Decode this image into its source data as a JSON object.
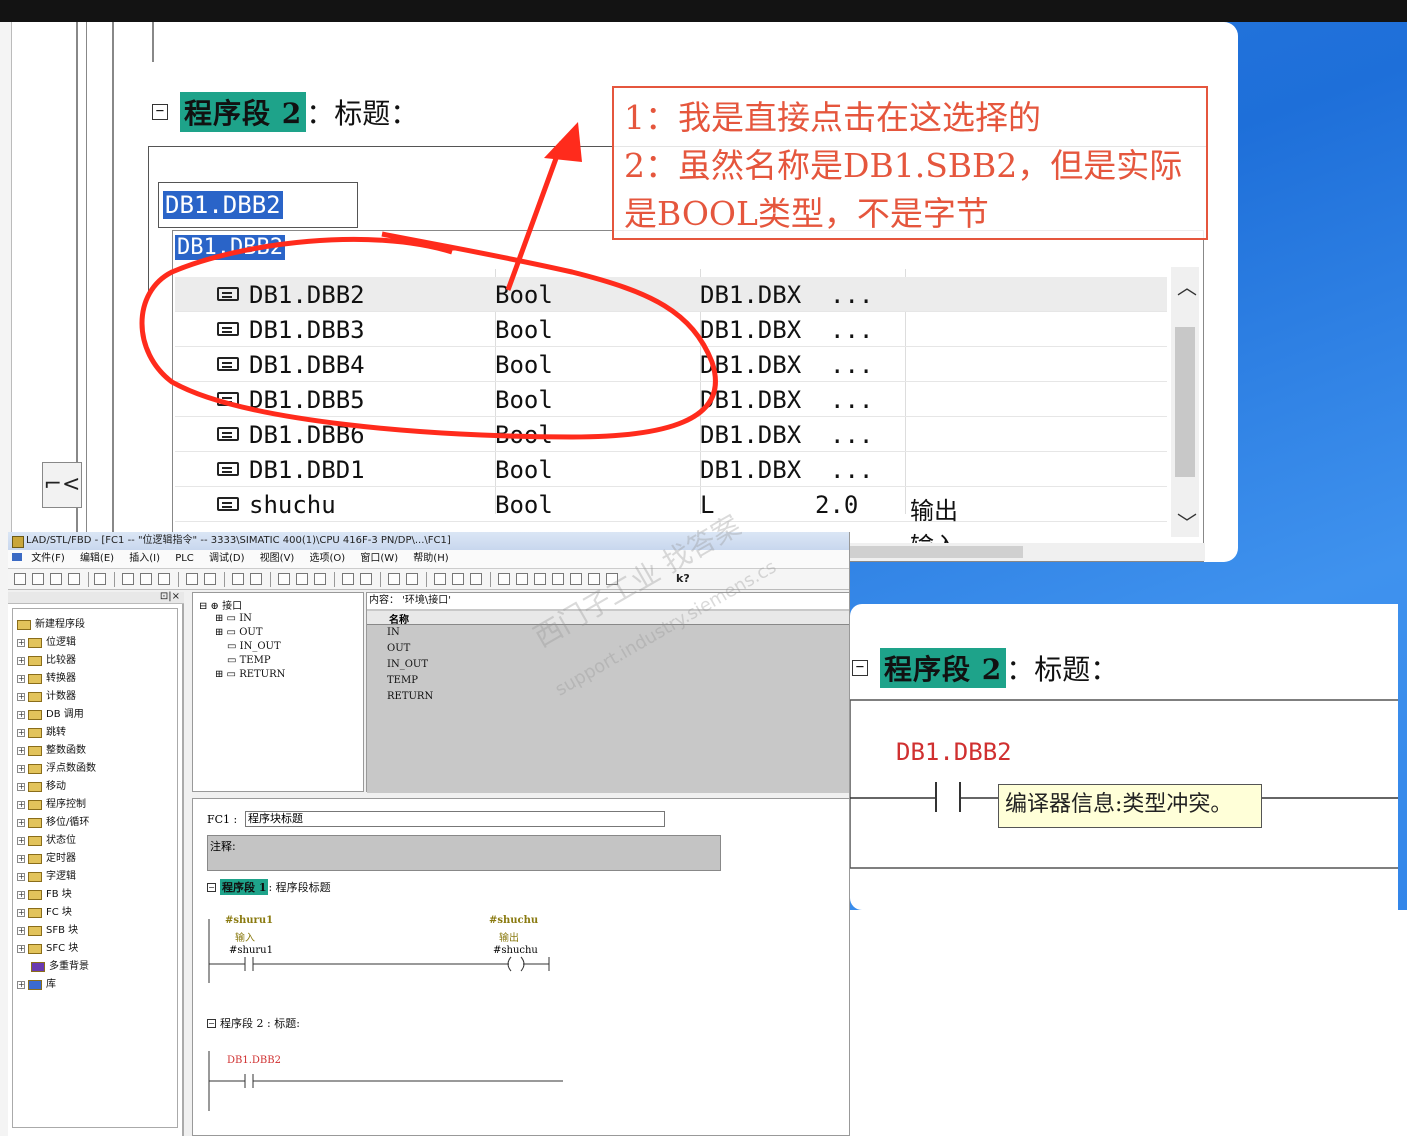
{
  "note": {
    "line1": "1：我是直接点击在这选择的",
    "line2": "2：虽然名称是DB1.SBB2，但是实际",
    "line3": "是BOOL类型，不是字节"
  },
  "zoom_top": {
    "network_prefix": "程序段 2",
    "network_suffix": "：标题：",
    "input_value": "DB1.DBB2",
    "dropdown_header": "DB1.DBB2",
    "rows": [
      {
        "name": "DB1.DBB2",
        "type": "Bool",
        "addr": "DB1.DBX",
        "extra": "...",
        "comment": ""
      },
      {
        "name": "DB1.DBB3",
        "type": "Bool",
        "addr": "DB1.DBX",
        "extra": "...",
        "comment": ""
      },
      {
        "name": "DB1.DBB4",
        "type": "Bool",
        "addr": "DB1.DBX",
        "extra": "...",
        "comment": ""
      },
      {
        "name": "DB1.DBB5",
        "type": "Bool",
        "addr": "DB1.DBX",
        "extra": "...",
        "comment": ""
      },
      {
        "name": "DB1.DBB6",
        "type": "Bool",
        "addr": "DB1.DBX",
        "extra": "...",
        "comment": ""
      },
      {
        "name": "DB1.DBD1",
        "type": "Bool",
        "addr": "DB1.DBX",
        "extra": "...",
        "comment": ""
      },
      {
        "name": "shuchu",
        "type": "Bool",
        "addr": "L",
        "extra": "2.0",
        "comment": "输出"
      },
      {
        "name": "",
        "type": "",
        "addr": "",
        "extra": "",
        "comment": "输入"
      }
    ],
    "toolbar_button": "⌐<"
  },
  "app": {
    "title": "LAD/STL/FBD  - [FC1 -- \"位逻辑指令\" -- 3333\\SIMATIC 400(1)\\CPU 416F-3 PN/DP\\...\\FC1]",
    "menu": [
      "文件(F)",
      "编辑(E)",
      "插入(I)",
      "PLC",
      "调试(D)",
      "视图(V)",
      "选项(O)",
      "窗口(W)",
      "帮助(H)"
    ],
    "tree": [
      "新建程序段",
      "位逻辑",
      "比较器",
      "转换器",
      "计数器",
      "DB 调用",
      "跳转",
      "整数函数",
      "浮点数函数",
      "移动",
      "程序控制",
      "移位/循环",
      "状态位",
      "定时器",
      "字逻辑",
      "FB 块",
      "FC 块",
      "SFB 块",
      "SFC 块",
      "多重背景",
      "库"
    ],
    "interface": [
      "接口",
      "IN",
      "OUT",
      "IN_OUT",
      "TEMP",
      "RETURN"
    ],
    "content_header": "内容：  '环境\\接口'",
    "content_col": "名称",
    "content_items": [
      "IN",
      "OUT",
      "IN_OUT",
      "TEMP",
      "RETURN"
    ],
    "editor": {
      "fc_label": "FC1 :",
      "fc_title": "程序块标题",
      "comment": "注释:",
      "net1_prefix": "程序段 1",
      "net1_suffix": ": 程序段标题",
      "in_sym": "#shuru1",
      "in_cmt": "输入",
      "in_addr": "#shuru1",
      "out_sym": "#shuchu",
      "out_cmt": "输出",
      "out_addr": "#shuchu",
      "net2": "程序段 2 : 标题:",
      "net2_addr": "DB1.DBB2"
    }
  },
  "watermark": {
    "line1": "西门子工业 找答案",
    "line2": "support.industry.siemens.cs"
  },
  "zoom_right": {
    "network_prefix": "程序段 2",
    "network_suffix": "：标题：",
    "address": "DB1.DBB2",
    "tooltip": "编译器信息:类型冲突。"
  }
}
